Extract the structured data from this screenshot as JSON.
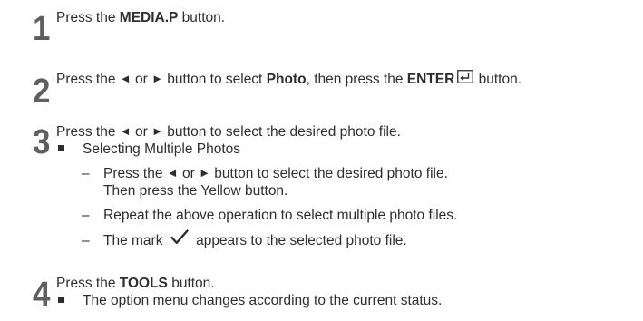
{
  "steps": [
    {
      "number": "1",
      "line_pre": "Press the ",
      "line_bold": "MEDIA.P",
      "line_post": " button."
    },
    {
      "number": "2",
      "pre": "Press the ",
      "mid": " or ",
      "mid2": " button to select ",
      "bold1": "Photo",
      "mid3": ", then press the ",
      "bold2": "ENTER",
      "post": " button."
    },
    {
      "number": "3",
      "pre": "Press the ",
      "mid": " or ",
      "post": " button to select the desired photo file.",
      "bullet": "Selecting Multiple Photos",
      "sub": [
        {
          "pre": "Press the ",
          "mid": " or ",
          "post": " button to select the desired photo file.",
          "cont": "Then press the Yellow button."
        },
        {
          "text": "Repeat the above operation to select multiple photo files."
        },
        {
          "pre": "The mark ",
          "post": " appears to the selected photo file."
        }
      ]
    },
    {
      "number": "4",
      "pre": "Press the ",
      "bold": "TOOLS",
      "post": " button.",
      "bullet": "The option menu changes according to the current status."
    }
  ],
  "glyphs": {
    "left": "◄",
    "right": "►",
    "dash": "–"
  },
  "icons": {
    "enter": "enter-icon",
    "check": "checkmark-icon",
    "bullet": "square-bullet-icon"
  }
}
